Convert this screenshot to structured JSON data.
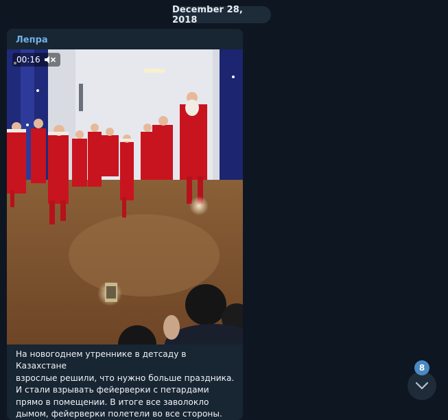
{
  "chat": {
    "date_separator": "December 28, 2018"
  },
  "message": {
    "sender": "Лепра",
    "video": {
      "duration": "00:16",
      "mute_icon": "muted-speaker-icon"
    },
    "caption": [
      "На новогоднем утреннике в детсаду в Казахстане",
      "взрослые решили, что нужно больше праздника.",
      "И стали взрывать фейерверки с петардами",
      "прямо в помещении. В итоге все заволокло",
      "дымом, фейерверки полетели во все стороны."
    ]
  },
  "scroll_down": {
    "icon": "chevron-down-icon",
    "unread_count": "8"
  },
  "colors": {
    "background": "#0e1621",
    "bubble": "#182533",
    "sender_name": "#6fb1e8",
    "badge": "#4a8ac4"
  }
}
